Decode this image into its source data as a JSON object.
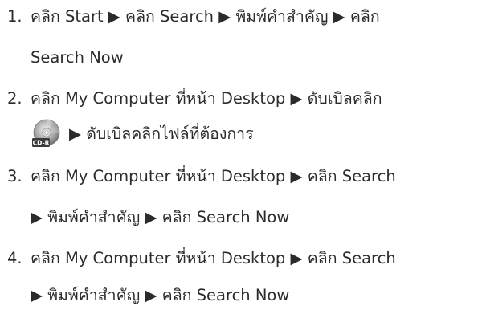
{
  "steps": [
    {
      "number": "1.",
      "line1": "คลิก Start ▶ คลิก Search ▶ พิมพ์คำสำคัญ ▶ คลิก",
      "line2": "Search Now"
    },
    {
      "number": "2.",
      "line1": "คลิก My Computer ที่หน้า Desktop ▶ ดับเบิลคลิก",
      "icon": "cd-r-disc-icon",
      "icon_label": "CD-R",
      "line2": "▶ ดับเบิลคลิกไฟล์ที่ต้องการ"
    },
    {
      "number": "3.",
      "line1": "คลิก My Computer ที่หน้า Desktop ▶ คลิก Search",
      "line2": "▶ พิมพ์คำสำคัญ ▶ คลิก Search Now"
    },
    {
      "number": "4.",
      "line1": "คลิก My Computer ที่หน้า Desktop ▶ คลิก Search",
      "line2": "▶ พิมพ์คำสำคัญ ▶ คลิก Search Now"
    }
  ]
}
